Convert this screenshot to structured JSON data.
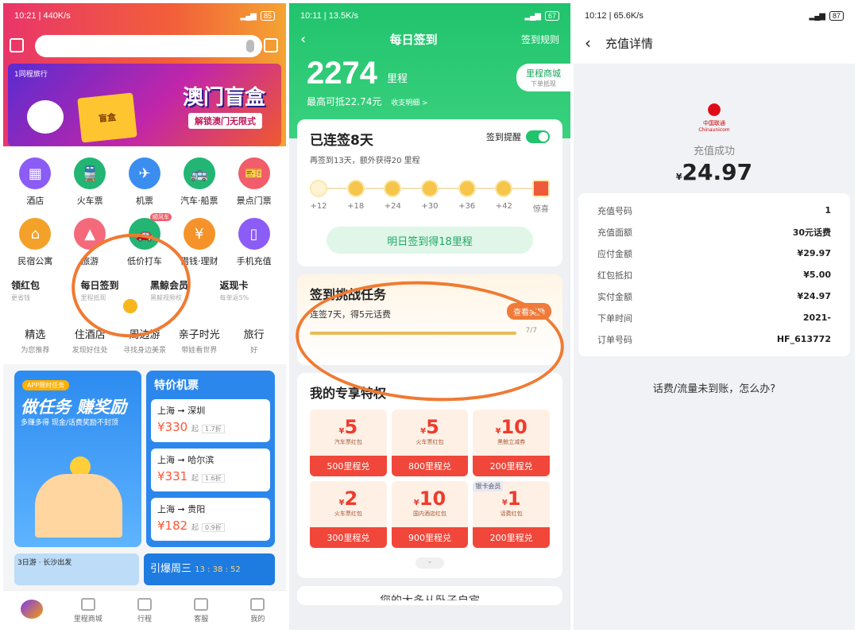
{
  "left": {
    "status": {
      "time": "10:21",
      "speed": "440K/s",
      "battery": "85"
    },
    "banner": {
      "brand": "1同程旅行",
      "title": "澳门盲盒",
      "subtitle": "解锁澳门无限式",
      "box_text": "盲盒"
    },
    "grid": [
      {
        "label": "酒店",
        "color": "#8b5cf6",
        "icon": "hotel-icon",
        "glyph": "▦"
      },
      {
        "label": "火车票",
        "color": "#22b573",
        "icon": "train-icon",
        "glyph": "🚆"
      },
      {
        "label": "机票",
        "color": "#3b8ef0",
        "icon": "plane-icon",
        "glyph": "✈"
      },
      {
        "label": "汽车·船票",
        "color": "#22b573",
        "icon": "bus-icon",
        "glyph": "🚌"
      },
      {
        "label": "景点门票",
        "color": "#f25d6b",
        "icon": "ticket-icon",
        "glyph": "🎫"
      },
      {
        "label": "民宿公寓",
        "color": "#f4a12a",
        "icon": "house-icon",
        "glyph": "⌂"
      },
      {
        "label": "旅游",
        "color": "#f46a7b",
        "icon": "mountain-icon",
        "glyph": "▲"
      },
      {
        "label": "低价打车",
        "color": "#22b573",
        "icon": "car-icon",
        "glyph": "🚗",
        "badge": "顺风车"
      },
      {
        "label": "借钱·理财",
        "color": "#f5932a",
        "icon": "money-bag-icon",
        "glyph": "¥"
      },
      {
        "label": "手机充值",
        "color": "#8b5cf6",
        "icon": "phone-icon",
        "glyph": "▯"
      }
    ],
    "row3": [
      {
        "title": "领红包",
        "sub": "更省钱"
      },
      {
        "title": "每日签到",
        "sub": "里程抵现"
      },
      {
        "title": "黑鲸会员",
        "sub": "黑鲸视频权"
      },
      {
        "title": "返现卡",
        "sub": "每单返5%"
      }
    ],
    "tabs": [
      {
        "title": "精选",
        "sub": "为您推荐"
      },
      {
        "title": "住酒店",
        "sub": "发现好住处"
      },
      {
        "title": "周边游",
        "sub": "寻找身边美景"
      },
      {
        "title": "亲子时光",
        "sub": "带娃看世界"
      },
      {
        "title": "旅行",
        "sub": "好"
      }
    ],
    "promo": {
      "tag": "APP限时任务",
      "title": "做任务 赚奖励",
      "sub": "多赚多得 现金/话费奖励不封顶"
    },
    "flights": {
      "header": "特价机票",
      "items": [
        {
          "route": "上海 ➞ 深圳",
          "price": "¥330",
          "unit": "起",
          "discount": "1.7折"
        },
        {
          "route": "上海 ➞ 哈尔滨",
          "price": "¥331",
          "unit": "起",
          "discount": "1.6折"
        },
        {
          "route": "上海 ➞ 贵阳",
          "price": "¥182",
          "unit": "起",
          "discount": "0.9折"
        }
      ]
    },
    "bottom": {
      "left": "3日游 · 长沙出发",
      "right": "引爆周三",
      "timer": "13 : 38 : 52"
    },
    "tabbar": [
      "",
      "里程商城",
      "行程",
      "客服",
      "我的"
    ]
  },
  "middle": {
    "status": {
      "time": "10:11",
      "speed": "13.5K/s",
      "battery": "67"
    },
    "title": "每日签到",
    "rules": "签到规则",
    "miles": "2274",
    "miles_unit": "里程",
    "max_deduct": "最高可抵22.74元",
    "detail_link": "收支明细 >",
    "mall": {
      "label": "里程商城",
      "sub": "下单抵现"
    },
    "streak": {
      "title": "已连签8天",
      "sub": "再签到13天，额外获得20 里程",
      "reminder": "签到提醒"
    },
    "days": [
      "+12",
      "+18",
      "+24",
      "+30",
      "+36",
      "+42",
      "惊喜"
    ],
    "sign_button": "明日签到得18里程",
    "challenge": {
      "title": "签到挑战任务",
      "sub": "连签7天，得5元话费",
      "button": "查看奖励",
      "count": "7/7"
    },
    "privileges": {
      "title": "我的专享特权",
      "items": [
        {
          "amt": "5",
          "name": "汽车票红包",
          "cost": "500里程兑"
        },
        {
          "amt": "5",
          "name": "火车票红包",
          "cost": "800里程兑"
        },
        {
          "amt": "10",
          "name": "黑鲸立减券",
          "cost": "200里程兑"
        },
        {
          "amt": "2",
          "name": "火车票红包",
          "cost": "300里程兑"
        },
        {
          "amt": "10",
          "name": "国内酒店红包",
          "cost": "900里程兑"
        },
        {
          "amt": "1",
          "name": "话费红包",
          "cost": "200里程兑",
          "tag": "银卡会员"
        }
      ]
    },
    "cutoff": "您的大多从卧子自宾"
  },
  "right": {
    "status": {
      "time": "10:12",
      "speed": "65.6K/s",
      "battery": "87"
    },
    "title": "充值详情",
    "logo_text": "中国联通",
    "logo_sub": "Chinaunicom",
    "success": "充值成功",
    "amount": "24.97",
    "rows": [
      {
        "k": "充值号码",
        "v": "1"
      },
      {
        "k": "充值面额",
        "v": "30元话费"
      },
      {
        "k": "应付金额",
        "v": "¥29.97"
      },
      {
        "k": "红包抵扣",
        "v": "¥5.00"
      },
      {
        "k": "实付金额",
        "v": "¥24.97"
      },
      {
        "k": "下单时间",
        "v": "2021-"
      },
      {
        "k": "订单号码",
        "v": "HF_613772"
      }
    ],
    "help": "话费/流量未到账，怎么办?"
  }
}
